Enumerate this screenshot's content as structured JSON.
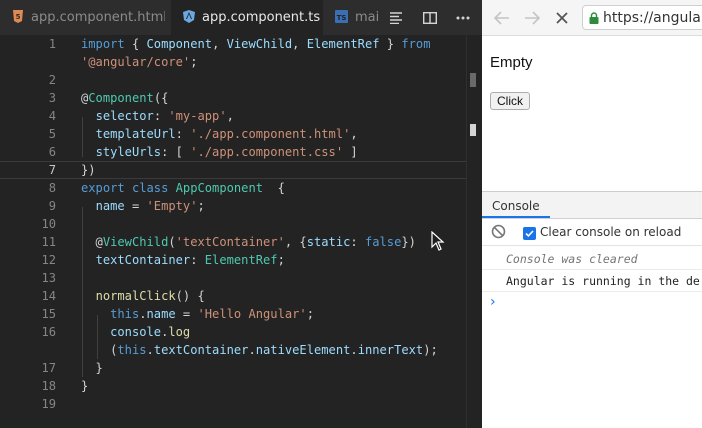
{
  "editor": {
    "tabs": [
      {
        "label": "app.component.html",
        "icon": "html5-icon",
        "active": false
      },
      {
        "label": "app.component.ts",
        "icon": "angular-icon",
        "active": true,
        "close": "×"
      },
      {
        "label": "main",
        "icon": "typescript-icon",
        "active": false
      }
    ],
    "toolbar": {
      "icons": [
        "outline-icon",
        "split-editor-icon",
        "more-icon"
      ]
    },
    "lines": [
      {
        "n": "1",
        "html": "<span class=\"k\">import</span> { <span class=\"p\">Component</span>, <span class=\"p\">ViewChild</span>, <span class=\"p\">ElementRef</span> } <span class=\"k\">from</span>"
      },
      {
        "n": "",
        "html": "<span class=\"s\">'@angular/core'</span>;"
      },
      {
        "n": "2",
        "html": ""
      },
      {
        "n": "3",
        "html": "@<span class=\"c\">Component</span>({"
      },
      {
        "n": "4",
        "html": "  <span class=\"p\">selector</span>: <span class=\"s\">'my-app'</span>,"
      },
      {
        "n": "5",
        "html": "  <span class=\"p\">templateUrl</span>: <span class=\"s\">'./app.component.html'</span>,"
      },
      {
        "n": "6",
        "html": "  <span class=\"p\">styleUrls</span>: [ <span class=\"s\">'./app.component.css'</span> ]"
      },
      {
        "n": "7",
        "html": "})",
        "current": true
      },
      {
        "n": "8",
        "html": "<span class=\"k\">export</span> <span class=\"k\">class</span> <span class=\"c\">AppComponent</span>  {"
      },
      {
        "n": "9",
        "html": "  <span class=\"p\">name</span> = <span class=\"s\">'Empty'</span>;"
      },
      {
        "n": "10",
        "html": ""
      },
      {
        "n": "11",
        "html": "  @<span class=\"c\">ViewChild</span>(<span class=\"s\">'textContainer'</span>, {<span class=\"p\">static</span>: <span class=\"b\">false</span>})"
      },
      {
        "n": "12",
        "html": "  <span class=\"p\">textContainer</span>: <span class=\"c\">ElementRef</span>;"
      },
      {
        "n": "13",
        "html": ""
      },
      {
        "n": "14",
        "html": "  <span class=\"f\">normalClick</span>() {"
      },
      {
        "n": "15",
        "html": "    <span class=\"k\">this</span>.<span class=\"p\">name</span> = <span class=\"s\">'Hello Angular'</span>;"
      },
      {
        "n": "16",
        "html": "    <span class=\"p\">console</span>.<span class=\"f\">log</span>"
      },
      {
        "n": "",
        "html": "    (<span class=\"k\">this</span>.<span class=\"p\">textContainer</span>.<span class=\"p\">nativeElement</span>.<span class=\"p\">innerText</span>);"
      },
      {
        "n": "17",
        "html": "  }"
      },
      {
        "n": "18",
        "html": "}"
      },
      {
        "n": "19",
        "html": ""
      }
    ]
  },
  "browser": {
    "url": "https://angular",
    "nav_icons": [
      "back-arrow-icon",
      "forward-arrow-icon",
      "stop-icon",
      "lock-icon"
    ],
    "page": {
      "title": "Empty",
      "button_label": "Click"
    },
    "devtools": {
      "tab": "Console",
      "clear_label": "Clear console on reload",
      "messages": [
        {
          "text": "Console was cleared",
          "kind": "info"
        },
        {
          "text": "Angular is running in the de",
          "kind": "log"
        }
      ],
      "prompt": "›"
    }
  },
  "colors": {
    "accent": "#1a73e8",
    "editor_bg": "#232323",
    "string": "#ce9178",
    "type": "#4ec9b0",
    "keyword": "#569cd6"
  }
}
